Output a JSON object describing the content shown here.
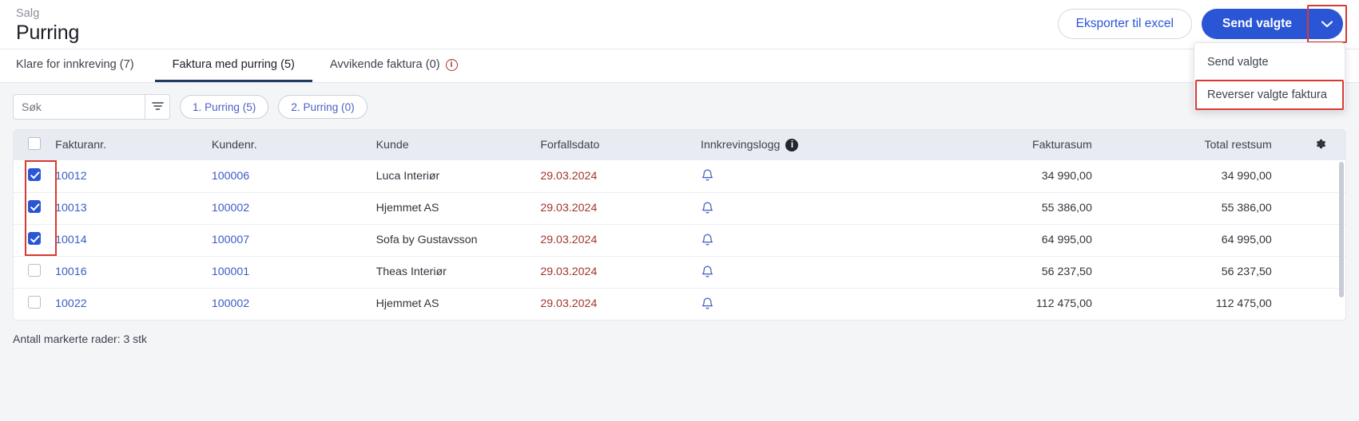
{
  "header": {
    "breadcrumb": "Salg",
    "title": "Purring",
    "export_label": "Eksporter til excel",
    "primary_label": "Send valgte",
    "caret_icon": "chevron-down-icon",
    "accent_color": "#2a56d6",
    "annotation_color": "#d83a32"
  },
  "dropdown": {
    "items": [
      {
        "label": "Send valgte",
        "annotated": false
      },
      {
        "label": "Reverser valgte faktura",
        "annotated": true
      }
    ]
  },
  "tabs": [
    {
      "label": "Klare for innkreving (7)",
      "active": false,
      "info": false
    },
    {
      "label": "Faktura med purring (5)",
      "active": true,
      "info": false
    },
    {
      "label": "Avvikende faktura (0)",
      "active": false,
      "info": true
    }
  ],
  "toolbar": {
    "search_placeholder": "Søk",
    "search_value": "",
    "filter_icon": "filter-icon",
    "chips": [
      {
        "label": "1. Purring (5)"
      },
      {
        "label": "2. Purring (0)"
      }
    ]
  },
  "table": {
    "columns": [
      {
        "key": "fakturanr",
        "label": "Fakturanr.",
        "align": "left"
      },
      {
        "key": "kundenr",
        "label": "Kundenr.",
        "align": "left"
      },
      {
        "key": "kunde",
        "label": "Kunde",
        "align": "left"
      },
      {
        "key": "forfallsdato",
        "label": "Forfallsdato",
        "align": "left"
      },
      {
        "key": "innkrevingslogg",
        "label": "Innkrevingslogg",
        "align": "left",
        "info": true
      },
      {
        "key": "fakturasum",
        "label": "Fakturasum",
        "align": "right"
      },
      {
        "key": "restsum",
        "label": "Total restsum",
        "align": "right"
      }
    ],
    "settings_icon": "gear-icon",
    "header_checkbox_checked": false,
    "rows": [
      {
        "checked": true,
        "fakturanr": "10012",
        "kundenr": "100006",
        "kunde": "Luca Interiør",
        "forfallsdato": "29.03.2024",
        "log_icon": "bell-icon",
        "fakturasum": "34 990,00",
        "restsum": "34 990,00"
      },
      {
        "checked": true,
        "fakturanr": "10013",
        "kundenr": "100002",
        "kunde": "Hjemmet AS",
        "forfallsdato": "29.03.2024",
        "log_icon": "bell-icon",
        "fakturasum": "55 386,00",
        "restsum": "55 386,00"
      },
      {
        "checked": true,
        "fakturanr": "10014",
        "kundenr": "100007",
        "kunde": "Sofa by Gustavsson",
        "forfallsdato": "29.03.2024",
        "log_icon": "bell-icon",
        "fakturasum": "64 995,00",
        "restsum": "64 995,00"
      },
      {
        "checked": false,
        "fakturanr": "10016",
        "kundenr": "100001",
        "kunde": "Theas Interiør",
        "forfallsdato": "29.03.2024",
        "log_icon": "bell-icon",
        "fakturasum": "56 237,50",
        "restsum": "56 237,50"
      },
      {
        "checked": false,
        "fakturanr": "10022",
        "kundenr": "100002",
        "kunde": "Hjemmet AS",
        "forfallsdato": "29.03.2024",
        "log_icon": "bell-icon",
        "fakturasum": "112 475,00",
        "restsum": "112 475,00"
      }
    ]
  },
  "footer": {
    "selected_rows_note": "Antall markerte rader: 3 stk"
  }
}
